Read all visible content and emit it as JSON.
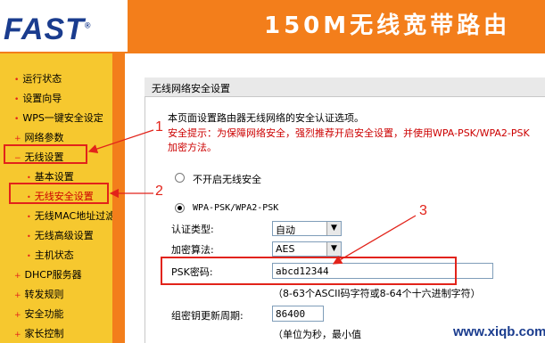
{
  "header": {
    "logo": "FAST",
    "banner_title": "150M无线宽带路由"
  },
  "sidebar": {
    "items": [
      {
        "label": "运行状态"
      },
      {
        "label": "设置向导"
      },
      {
        "label": "WPS一键安全设定"
      },
      {
        "label": "网络参数"
      },
      {
        "label": "无线设置"
      },
      {
        "label": "基本设置"
      },
      {
        "label": "无线安全设置"
      },
      {
        "label": "无线MAC地址过滤"
      },
      {
        "label": "无线高级设置"
      },
      {
        "label": "主机状态"
      },
      {
        "label": "DHCP服务器"
      },
      {
        "label": "转发规则"
      },
      {
        "label": "安全功能"
      },
      {
        "label": "家长控制"
      }
    ]
  },
  "panel": {
    "title": "无线网络安全设置",
    "intro": "本页面设置路由器无线网络的安全认证选项。",
    "warning_line1": "安全提示：为保障网络安全，强烈推荐开启安全设置，并使用WPA-PSK/WPA2-PSK",
    "warning_line2": "加密方法。",
    "option_none": "不开启无线安全",
    "option_wpa": "WPA-PSK/WPA2-PSK",
    "auth_label": "认证类型:",
    "auth_value": "自动",
    "enc_label": "加密算法:",
    "enc_value": "AES",
    "psk_label": "PSK密码:",
    "psk_value": "abcd12344",
    "psk_hint": "（8-63个ASCII码字符或8-64个十六进制字符）",
    "renew_label": "组密钥更新周期:",
    "renew_value": "86400",
    "renew_hint": "（单位为秒，最小值"
  },
  "annotations": {
    "n1": "1",
    "n2": "2",
    "n3": "3"
  },
  "watermark": "www.xiqb.com",
  "colors": {
    "brand_orange": "#f37e1b",
    "sidebar_yellow": "#f6c82f",
    "logo_blue": "#1a3c8e",
    "annotation_red": "#e2231a"
  }
}
